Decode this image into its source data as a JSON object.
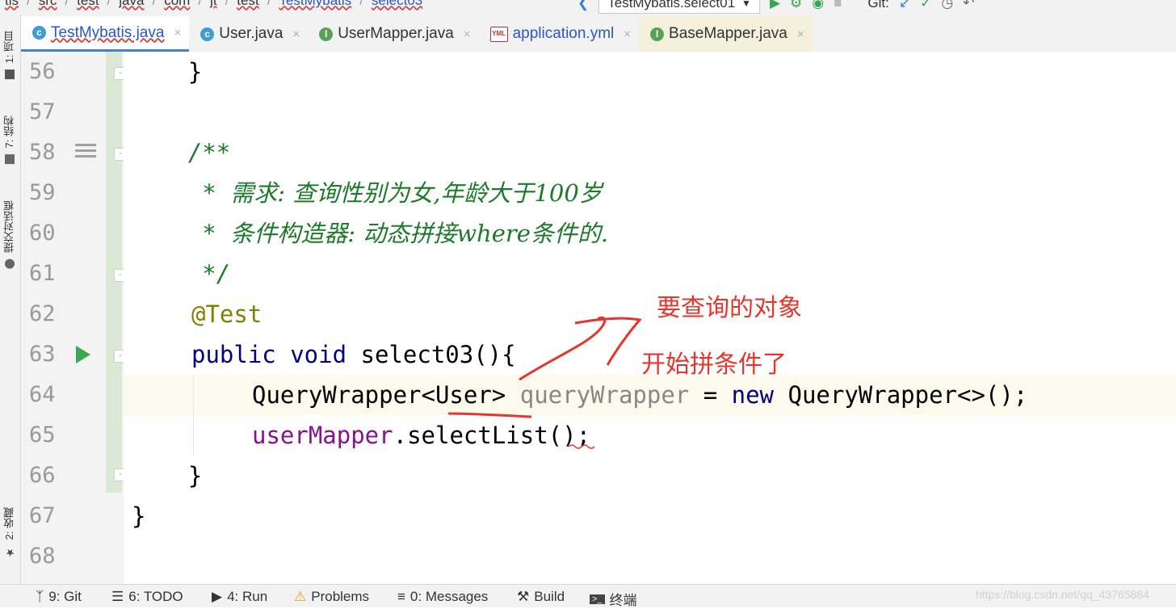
{
  "breadcrumb": {
    "items": [
      "tis",
      "src",
      "test",
      "java",
      "com",
      "jt",
      "test",
      "TestMybatis",
      "select03"
    ]
  },
  "toolbar": {
    "run_config": "TestMybatis.select01",
    "git_label": "Git:"
  },
  "left_strip": {
    "project": "1: 项目",
    "structure": "7: 结构",
    "commit": "提交对话框",
    "favorites": "2: 收藏"
  },
  "tabs": [
    {
      "label": "TestMybatis.java",
      "icon": "class-icon"
    },
    {
      "label": "User.java",
      "icon": "class-icon"
    },
    {
      "label": "UserMapper.java",
      "icon": "interface-icon"
    },
    {
      "label": "application.yml",
      "icon": "yml-icon"
    },
    {
      "label": "BaseMapper.java",
      "icon": "interface-icon"
    }
  ],
  "tab_close": "×",
  "line_numbers": [
    "56",
    "57",
    "58",
    "59",
    "60",
    "61",
    "62",
    "63",
    "64",
    "65",
    "66",
    "67",
    "68"
  ],
  "code": {
    "l56": "    }",
    "l58": "    /**",
    "l59_star": "     * ",
    "l59_text": "需求: 查询性别为女,年龄大于100岁",
    "l60_star": "     * ",
    "l60_text": "条件构造器: 动态拼接where条件的.",
    "l61": "     */",
    "l62": "@Test",
    "l63_kw": "public void ",
    "l63_rest": "select03(){",
    "l64_type": "QueryWrapper<User> ",
    "l64_var": "queryWrapper",
    "l64_eq": " = ",
    "l64_new": "new",
    "l64_rest": " QueryWrapper<>();",
    "l65_field": "userMapper",
    "l65_rest": ".selectList();",
    "l66": "    }",
    "l67": "}"
  },
  "annotations": {
    "note1": "要查询的对象",
    "note2": "开始拼条件了",
    "color": "#e8352c"
  },
  "bottom_bar": {
    "git": "9: Git",
    "todo": "6: TODO",
    "run": "4: Run",
    "problems": "Problems",
    "messages": "0: Messages",
    "build": "Build",
    "terminal": "终端"
  },
  "watermark": "https://blog.csdn.net/qq_43765884"
}
